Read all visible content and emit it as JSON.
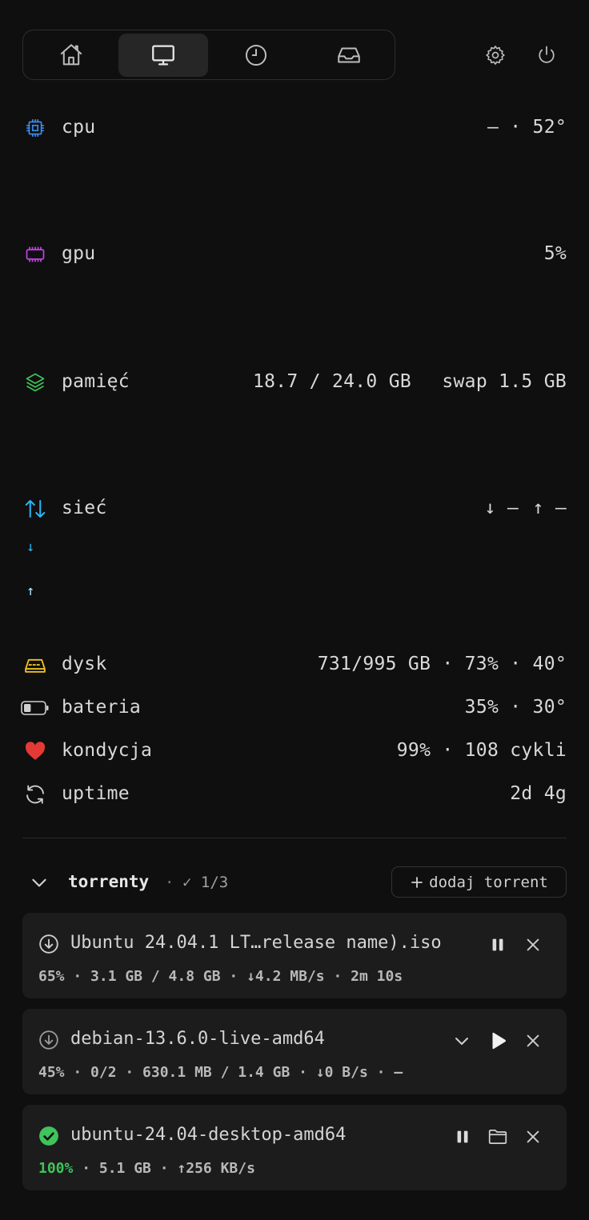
{
  "nav": {
    "tabs": [
      {
        "name": "home-icon",
        "active": false
      },
      {
        "name": "monitor-icon",
        "active": true
      },
      {
        "name": "clock-icon",
        "active": false
      },
      {
        "name": "inbox-icon",
        "active": false
      }
    ]
  },
  "stats": {
    "cpu": {
      "label": "cpu",
      "value": "— · 52°",
      "icon_color": "#3b8ff0"
    },
    "gpu": {
      "label": "gpu",
      "value": "5%",
      "icon_color": "#c040e0"
    },
    "memory": {
      "label": "pamięć",
      "value": "18.7 / 24.0 GB",
      "swap": "swap 1.5 GB",
      "icon_color": "#3fc35a"
    },
    "network": {
      "label": "sieć",
      "down": "↓ —",
      "up": "↑ —",
      "down_arrow": "↓",
      "up_arrow": "↑",
      "icon_color": "#29b6f6"
    },
    "disk": {
      "label": "dysk",
      "value": "731/995 GB · 73% · 40°",
      "icon_color": "#f0c020"
    },
    "battery": {
      "label": "bateria",
      "value": "35% · 30°",
      "level": 0.35
    },
    "health": {
      "label": "kondycja",
      "value": "99% · 108 cykli",
      "icon_color": "#e53935"
    },
    "uptime": {
      "label": "uptime",
      "value": "2d 4g"
    }
  },
  "torrents": {
    "title": "torrenty",
    "count": "✓ 1/3",
    "add_label": "dodaj torrent",
    "items": [
      {
        "name": "Ubuntu 24.04.1 LT…release name).iso",
        "stats_pct": "65%",
        "stats_rest": " · 3.1 GB / 4.8 GB · ↓4.2 MB/s · 2m 10s"
      },
      {
        "name": "debian-13.6.0-live-amd64",
        "stats_pct": "45%",
        "stats_rest": " · 0/2 · 630.1 MB / 1.4 GB · ↓0 B/s · —"
      },
      {
        "name": "ubuntu-24.04-desktop-amd64",
        "stats_pct": "100%",
        "stats_rest": " · 5.1 GB · ↑256 KB/s"
      }
    ]
  }
}
